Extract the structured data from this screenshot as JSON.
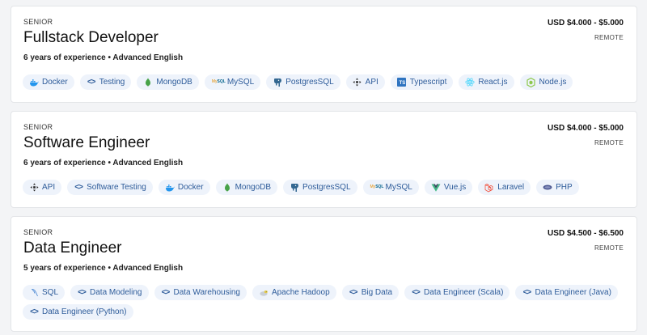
{
  "jobs": [
    {
      "level": "SENIOR",
      "title": "Fullstack Developer",
      "requirements": "6 years of experience • Advanced English",
      "salary": "USD $4.000 - $5.000",
      "location": "REMOTE",
      "tags": [
        {
          "label": "Docker",
          "icon": "docker-icon"
        },
        {
          "label": "Testing",
          "icon": "code-icon"
        },
        {
          "label": "MongoDB",
          "icon": "mongodb-icon"
        },
        {
          "label": "MySQL",
          "icon": "mysql-icon"
        },
        {
          "label": "PostgresSQL",
          "icon": "postgresql-icon"
        },
        {
          "label": "API",
          "icon": "api-icon"
        },
        {
          "label": "Typescript",
          "icon": "typescript-icon"
        },
        {
          "label": "React.js",
          "icon": "react-icon"
        },
        {
          "label": "Node.js",
          "icon": "nodejs-icon"
        }
      ]
    },
    {
      "level": "SENIOR",
      "title": "Software Engineer",
      "requirements": "6 years of experience • Advanced English",
      "salary": "USD $4.000 - $5.000",
      "location": "REMOTE",
      "tags": [
        {
          "label": "API",
          "icon": "api-icon"
        },
        {
          "label": "Software Testing",
          "icon": "code-icon"
        },
        {
          "label": "Docker",
          "icon": "docker-icon"
        },
        {
          "label": "MongoDB",
          "icon": "mongodb-icon"
        },
        {
          "label": "PostgresSQL",
          "icon": "postgresql-icon"
        },
        {
          "label": "MySQL",
          "icon": "mysql-icon"
        },
        {
          "label": "Vue.js",
          "icon": "vue-icon"
        },
        {
          "label": "Laravel",
          "icon": "laravel-icon"
        },
        {
          "label": "PHP",
          "icon": "php-icon"
        }
      ]
    },
    {
      "level": "SENIOR",
      "title": "Data Engineer",
      "requirements": "5 years of experience • Advanced English",
      "salary": "USD $4.500 - $6.500",
      "location": "REMOTE",
      "tags": [
        {
          "label": "SQL",
          "icon": "sql-icon"
        },
        {
          "label": "Data Modeling",
          "icon": "code-icon"
        },
        {
          "label": "Data Warehousing",
          "icon": "code-icon"
        },
        {
          "label": "Apache Hadoop",
          "icon": "hadoop-icon"
        },
        {
          "label": "Big Data",
          "icon": "code-icon"
        },
        {
          "label": "Data Engineer (Scala)",
          "icon": "code-icon"
        },
        {
          "label": "Data Engineer (Java)",
          "icon": "code-icon"
        },
        {
          "label": "Data Engineer (Python)",
          "icon": "code-icon"
        }
      ]
    }
  ],
  "colors": {
    "tag_bg": "#eef3fb",
    "tag_text": "#2e5c9a",
    "card_border": "#e3e5e8",
    "page_bg": "#f3f4f6"
  }
}
